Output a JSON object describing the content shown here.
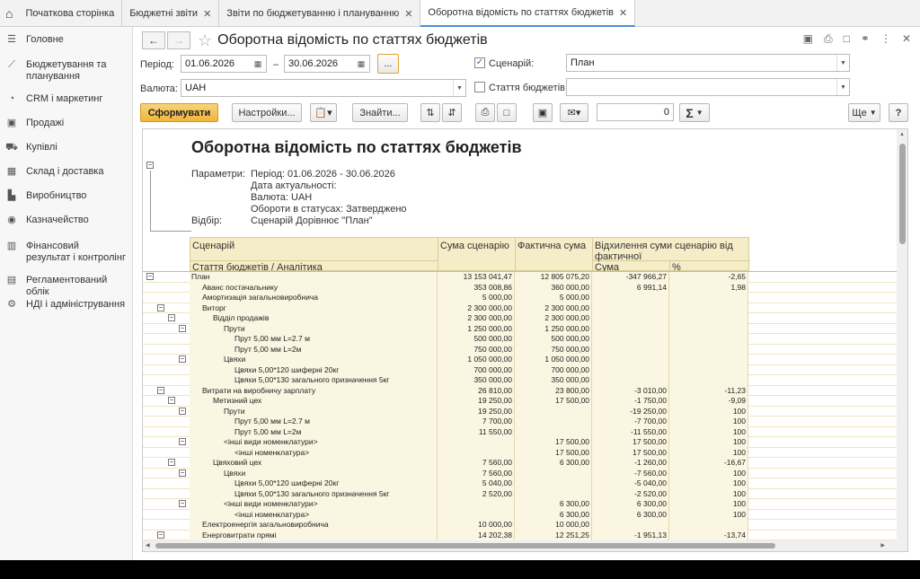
{
  "tabs": [
    {
      "label": "Початкова сторінка",
      "close": false,
      "active": false
    },
    {
      "label": "Бюджетні звіти",
      "close": true,
      "active": false
    },
    {
      "label": "Звіти по бюджетуванню і плануванню",
      "close": true,
      "active": false
    },
    {
      "label": "Оборотна відомість по статтях бюджетів",
      "close": true,
      "active": true
    }
  ],
  "sidebar": [
    {
      "label": "Головне",
      "icon": "menu-icon"
    },
    {
      "label": "Бюджетування та планування",
      "icon": "chart-line-icon"
    },
    {
      "label": "CRM і маркетинг",
      "icon": "pie-icon"
    },
    {
      "label": "Продажі",
      "icon": "bag-icon"
    },
    {
      "label": "Купівлі",
      "icon": "cart-icon"
    },
    {
      "label": "Склад і доставка",
      "icon": "grid-icon"
    },
    {
      "label": "Виробництво",
      "icon": "factory-icon"
    },
    {
      "label": "Казначейство",
      "icon": "coin-icon"
    },
    {
      "label": "Фінансовий результат і контролінг",
      "icon": "bar-chart-icon"
    },
    {
      "label": "Регламентований облік",
      "icon": "document-icon"
    },
    {
      "label": "НДІ і адміністрування",
      "icon": "gear-icon"
    }
  ],
  "form": {
    "title": "Оборотна відомість по статтях бюджетів",
    "period_label": "Період:",
    "date_from": "01.06.2026",
    "dash": "–",
    "date_to": "30.06.2026",
    "dots": "...",
    "currency_label": "Валюта:",
    "currency": "UAH",
    "scenario_label": "Сценарій:",
    "scenario": "План",
    "scenario_checked": true,
    "article_label": "Стаття бюджетів:",
    "article": "",
    "btn_form": "Сформувати",
    "btn_settings": "Настройки...",
    "btn_find": "Знайти...",
    "sum_value": "0",
    "sigma": "Σ",
    "btn_more": "Ще",
    "btn_help": "?"
  },
  "report": {
    "title": "Оборотна відомість по статтях бюджетів",
    "params_label": "Параметри:",
    "params_lines": [
      "Період: 01.06.2026 - 30.06.2026",
      "Дата актуальності:",
      "Валюта: UAH",
      "Обороти в статусах: Затверджено"
    ],
    "filter_label": "Відбір:",
    "filter_value": "Сценарій Дорівнює \"План\"",
    "col_scenario": "Сценарій",
    "col_article": "Стаття бюджетів / Аналітика",
    "col_plan": "Сума сценарію",
    "col_fact": "Фактична сума",
    "col_dev": "Відхилення суми сценарію від фактичної",
    "col_dev_sum": "Сума",
    "col_dev_pct": "%"
  },
  "rows": [
    {
      "name": "План",
      "lvl": 0,
      "plan": "13 153 041,47",
      "fact": "12 805 075,20",
      "dev": "-347 966,27",
      "pct": "-2,65",
      "tog": true
    },
    {
      "name": "Аванс постачальнику",
      "lvl": 1,
      "plan": "353 008,86",
      "fact": "360 000,00",
      "dev": "6 991,14",
      "pct": "1,98"
    },
    {
      "name": "Амортизація загальновиробнича",
      "lvl": 1,
      "plan": "5 000,00",
      "fact": "5 000,00",
      "dev": "",
      "pct": ""
    },
    {
      "name": "Виторг",
      "lvl": 1,
      "plan": "2 300 000,00",
      "fact": "2 300 000,00",
      "dev": "",
      "pct": "",
      "tog": true
    },
    {
      "name": "Відділ продажів",
      "lvl": 2,
      "plan": "2 300 000,00",
      "fact": "2 300 000,00",
      "dev": "",
      "pct": "",
      "tog": true
    },
    {
      "name": "Прути",
      "lvl": 3,
      "plan": "1 250 000,00",
      "fact": "1 250 000,00",
      "dev": "",
      "pct": "",
      "tog": true
    },
    {
      "name": "Прут 5,00 мм L=2.7 м",
      "lvl": 4,
      "plan": "500 000,00",
      "fact": "500 000,00",
      "dev": "",
      "pct": ""
    },
    {
      "name": "Прут 5,00 мм L=2м",
      "lvl": 4,
      "plan": "750 000,00",
      "fact": "750 000,00",
      "dev": "",
      "pct": ""
    },
    {
      "name": "Цвяхи",
      "lvl": 3,
      "plan": "1 050 000,00",
      "fact": "1 050 000,00",
      "dev": "",
      "pct": "",
      "tog": true
    },
    {
      "name": "Цвяхи 5,00*120 шиферні 20кг",
      "lvl": 4,
      "plan": "700 000,00",
      "fact": "700 000,00",
      "dev": "",
      "pct": ""
    },
    {
      "name": "Цвяхи 5,00*130 загального призначення 5кг",
      "lvl": 4,
      "plan": "350 000,00",
      "fact": "350 000,00",
      "dev": "",
      "pct": ""
    },
    {
      "name": "Витрати на виробничу зарплату",
      "lvl": 1,
      "plan": "26 810,00",
      "fact": "23 800,00",
      "dev": "-3 010,00",
      "pct": "-11,23",
      "tog": true
    },
    {
      "name": "Метизний цех",
      "lvl": 2,
      "plan": "19 250,00",
      "fact": "17 500,00",
      "dev": "-1 750,00",
      "pct": "-9,09",
      "tog": true
    },
    {
      "name": "Прути",
      "lvl": 3,
      "plan": "19 250,00",
      "fact": "",
      "dev": "-19 250,00",
      "pct": "100",
      "tog": true
    },
    {
      "name": "Прут 5,00 мм L=2.7 м",
      "lvl": 4,
      "plan": "7 700,00",
      "fact": "",
      "dev": "-7 700,00",
      "pct": "100"
    },
    {
      "name": "Прут 5,00 мм L=2м",
      "lvl": 4,
      "plan": "11 550,00",
      "fact": "",
      "dev": "-11 550,00",
      "pct": "100"
    },
    {
      "name": "<інші види номенклатури>",
      "lvl": 3,
      "plan": "",
      "fact": "17 500,00",
      "dev": "17 500,00",
      "pct": "100",
      "tog": true
    },
    {
      "name": "<інші номенклатура>",
      "lvl": 4,
      "plan": "",
      "fact": "17 500,00",
      "dev": "17 500,00",
      "pct": "100"
    },
    {
      "name": "Цвяховий цех",
      "lvl": 2,
      "plan": "7 560,00",
      "fact": "6 300,00",
      "dev": "-1 260,00",
      "pct": "-16,67",
      "tog": true
    },
    {
      "name": "Цвяхи",
      "lvl": 3,
      "plan": "7 560,00",
      "fact": "",
      "dev": "-7 560,00",
      "pct": "100",
      "tog": true
    },
    {
      "name": "Цвяхи 5,00*120 шиферні 20кг",
      "lvl": 4,
      "plan": "5 040,00",
      "fact": "",
      "dev": "-5 040,00",
      "pct": "100"
    },
    {
      "name": "Цвяхи 5,00*130 загального призначення 5кг",
      "lvl": 4,
      "plan": "2 520,00",
      "fact": "",
      "dev": "-2 520,00",
      "pct": "100"
    },
    {
      "name": "<інші види номенклатури>",
      "lvl": 3,
      "plan": "",
      "fact": "6 300,00",
      "dev": "6 300,00",
      "pct": "100",
      "tog": true
    },
    {
      "name": "<інші номенклатура>",
      "lvl": 4,
      "plan": "",
      "fact": "6 300,00",
      "dev": "6 300,00",
      "pct": "100"
    },
    {
      "name": "Електроенергія загальновиробнича",
      "lvl": 1,
      "plan": "10 000,00",
      "fact": "10 000,00",
      "dev": "",
      "pct": ""
    },
    {
      "name": "Енерговитрати прямі",
      "lvl": 1,
      "plan": "14 202,38",
      "fact": "12 251,25",
      "dev": "-1 951,13",
      "pct": "-13,74",
      "tog": true
    }
  ]
}
